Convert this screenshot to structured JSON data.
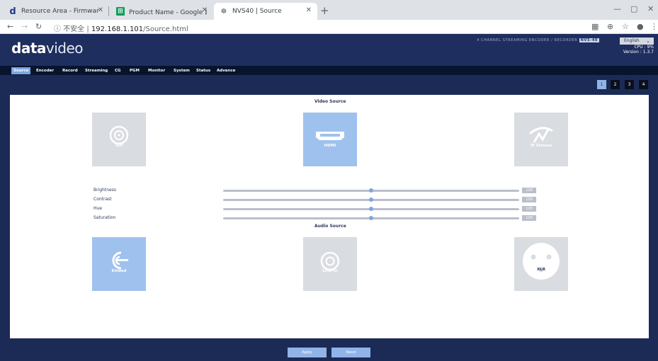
{
  "browser": {
    "tabs": [
      {
        "title": "Resource Area - Firmware, Soft",
        "favicon": "d"
      },
      {
        "title": "Product Name - Google 試算表",
        "favicon": "⊞"
      },
      {
        "title": "NVS40 | Source",
        "favicon": "☸"
      }
    ],
    "security": "不安全",
    "url_host": "192.168.1.101",
    "url_path": "/Source.html"
  },
  "header": {
    "logo_bold": "data",
    "logo_thin": "video",
    "device_name": "4 CHANNEL STREAMING ENCODER / RECORDER",
    "model": "NVS-40",
    "language": "English",
    "cpu": "CPU : 9%",
    "version": "Version : 1.3.7"
  },
  "nav": {
    "items": [
      "Source",
      "Encoder",
      "Record",
      "Streaming",
      "CG",
      "PGM",
      "Monitor",
      "System",
      "Status",
      "Advance"
    ],
    "active": "Source"
  },
  "channels": [
    "1",
    "2",
    "3",
    "4"
  ],
  "video_source": {
    "title": "Video Source",
    "options": [
      "SDI",
      "HDMI",
      "IP Stream"
    ],
    "selected": "HDMI"
  },
  "adjustments": {
    "rows": [
      {
        "label": "Brightness",
        "value": "128",
        "level": 0.5
      },
      {
        "label": "Contrast",
        "value": "128",
        "level": 0.5
      },
      {
        "label": "Hue",
        "value": "128",
        "level": 0.5
      },
      {
        "label": "Saturation",
        "value": "128",
        "level": 0.5
      }
    ]
  },
  "audio_source": {
    "title": "Audio Source",
    "options": [
      "Embed",
      "Line-In",
      "XLR"
    ],
    "selected": "Embed"
  },
  "buttons": {
    "apply": "Apply",
    "reset": "Reset"
  },
  "colors": {
    "header_bg": "#1e2e5f",
    "nav_bg": "#07142e",
    "accent": "#7da6e0",
    "selected_box": "#9fc1ee",
    "idle_box": "#d9dce0"
  }
}
